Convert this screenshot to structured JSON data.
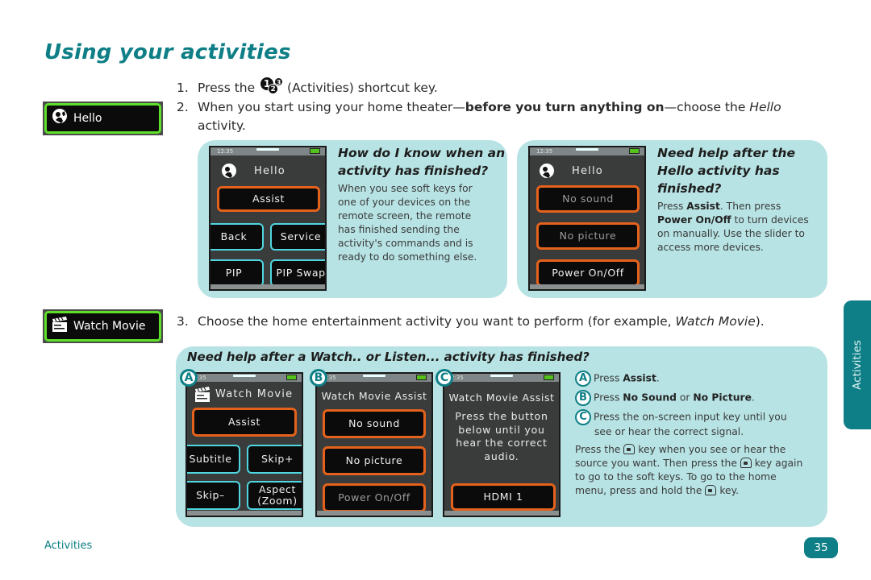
{
  "page": {
    "title": "Using your activities",
    "footer_section": "Activities",
    "page_number": "35",
    "side_tab": "Activities"
  },
  "side_buttons": {
    "hello": {
      "label": "Hello",
      "icon": "hello-assistant-icon"
    },
    "watch_movie": {
      "label": "Watch Movie",
      "icon": "clapperboard-icon"
    }
  },
  "steps": [
    {
      "num": "1.",
      "pre": "Press the",
      "icon": "activities-123-icon",
      "post": "(Activities) shortcut key."
    },
    {
      "num": "2.",
      "pre": "When you start using your home theater—",
      "bold": "before you turn anything on",
      "mid": "—choose the ",
      "italic": "Hello",
      "post": "activity."
    },
    {
      "num": "3.",
      "pre": "Choose the home entertainment activity you want to perform (for example, ",
      "italic": "Watch Movie",
      "post": ")."
    }
  ],
  "activities_icon_digits": [
    "1",
    "2",
    "3"
  ],
  "panel1": {
    "heading_line1": "How do I know when an",
    "heading_line2": "activity has finished?",
    "body": "When you see soft keys for one of your devices on the remote screen, the remote has finished sending the activity's commands and is ready to do something else.",
    "screen": {
      "time": "12:35",
      "title": "Hello",
      "buttons": [
        "Assist",
        "Back",
        "Service",
        "PIP",
        "PIP Swap"
      ]
    }
  },
  "panel2": {
    "heading_line1": "Need help after the",
    "heading_line2": "Hello activity has",
    "heading_line3": "finished?",
    "body_pre": "Press ",
    "body_bold1": "Assist",
    "body_mid": ". Then press ",
    "body_bold2": "Power On/Off",
    "body_post": " to turn devices on manually. Use the slider to access more devices.",
    "screen": {
      "time": "12:35",
      "title": "Hello",
      "buttons": [
        "No sound",
        "No picture",
        "Power On/Off"
      ]
    }
  },
  "panel3": {
    "heading": "Need help after a Watch.. or Listen... activity has finished?",
    "screen_a": {
      "badge": "A",
      "time": "2:35",
      "title": "Watch Movie",
      "buttons": [
        "Assist",
        "Subtitle",
        "Skip+",
        "Skip–",
        "Aspect",
        "(Zoom)"
      ]
    },
    "screen_b": {
      "badge": "B",
      "time": "2:35",
      "title": "Watch Movie Assist",
      "buttons": [
        "No sound",
        "No picture",
        "Power On/Off"
      ]
    },
    "screen_c": {
      "badge": "C",
      "time": "2:35",
      "title": "Watch Movie Assist",
      "message_lines": [
        "Press the button",
        "below until you",
        "hear the correct",
        "audio."
      ],
      "button": "HDMI 1"
    },
    "instructions": [
      {
        "badge": "A",
        "pre": "Press ",
        "bold": "Assist",
        "post": "."
      },
      {
        "badge": "B",
        "pre": "Press ",
        "bold": "No Sound",
        "mid": " or ",
        "bold2": "No Picture",
        "post": "."
      },
      {
        "badge": "C",
        "line1": "Press the on-screen input key until you",
        "line2": "see or hear the correct signal."
      }
    ],
    "home_note": {
      "p1": "Press the",
      "p2": "key when you see or hear the",
      "p3": "source you want. Then press the",
      "p4": "key again",
      "p5": "to go to the soft keys. To go to the home",
      "p6": "menu, press and hold the",
      "p7": "key."
    }
  },
  "colors": {
    "accent_teal": "#0e7f86",
    "panel_bg": "#b8e3e4",
    "button_orange": "#e4621c",
    "button_cyan": "#4fd6e0",
    "activity_green": "#5ee02a"
  }
}
